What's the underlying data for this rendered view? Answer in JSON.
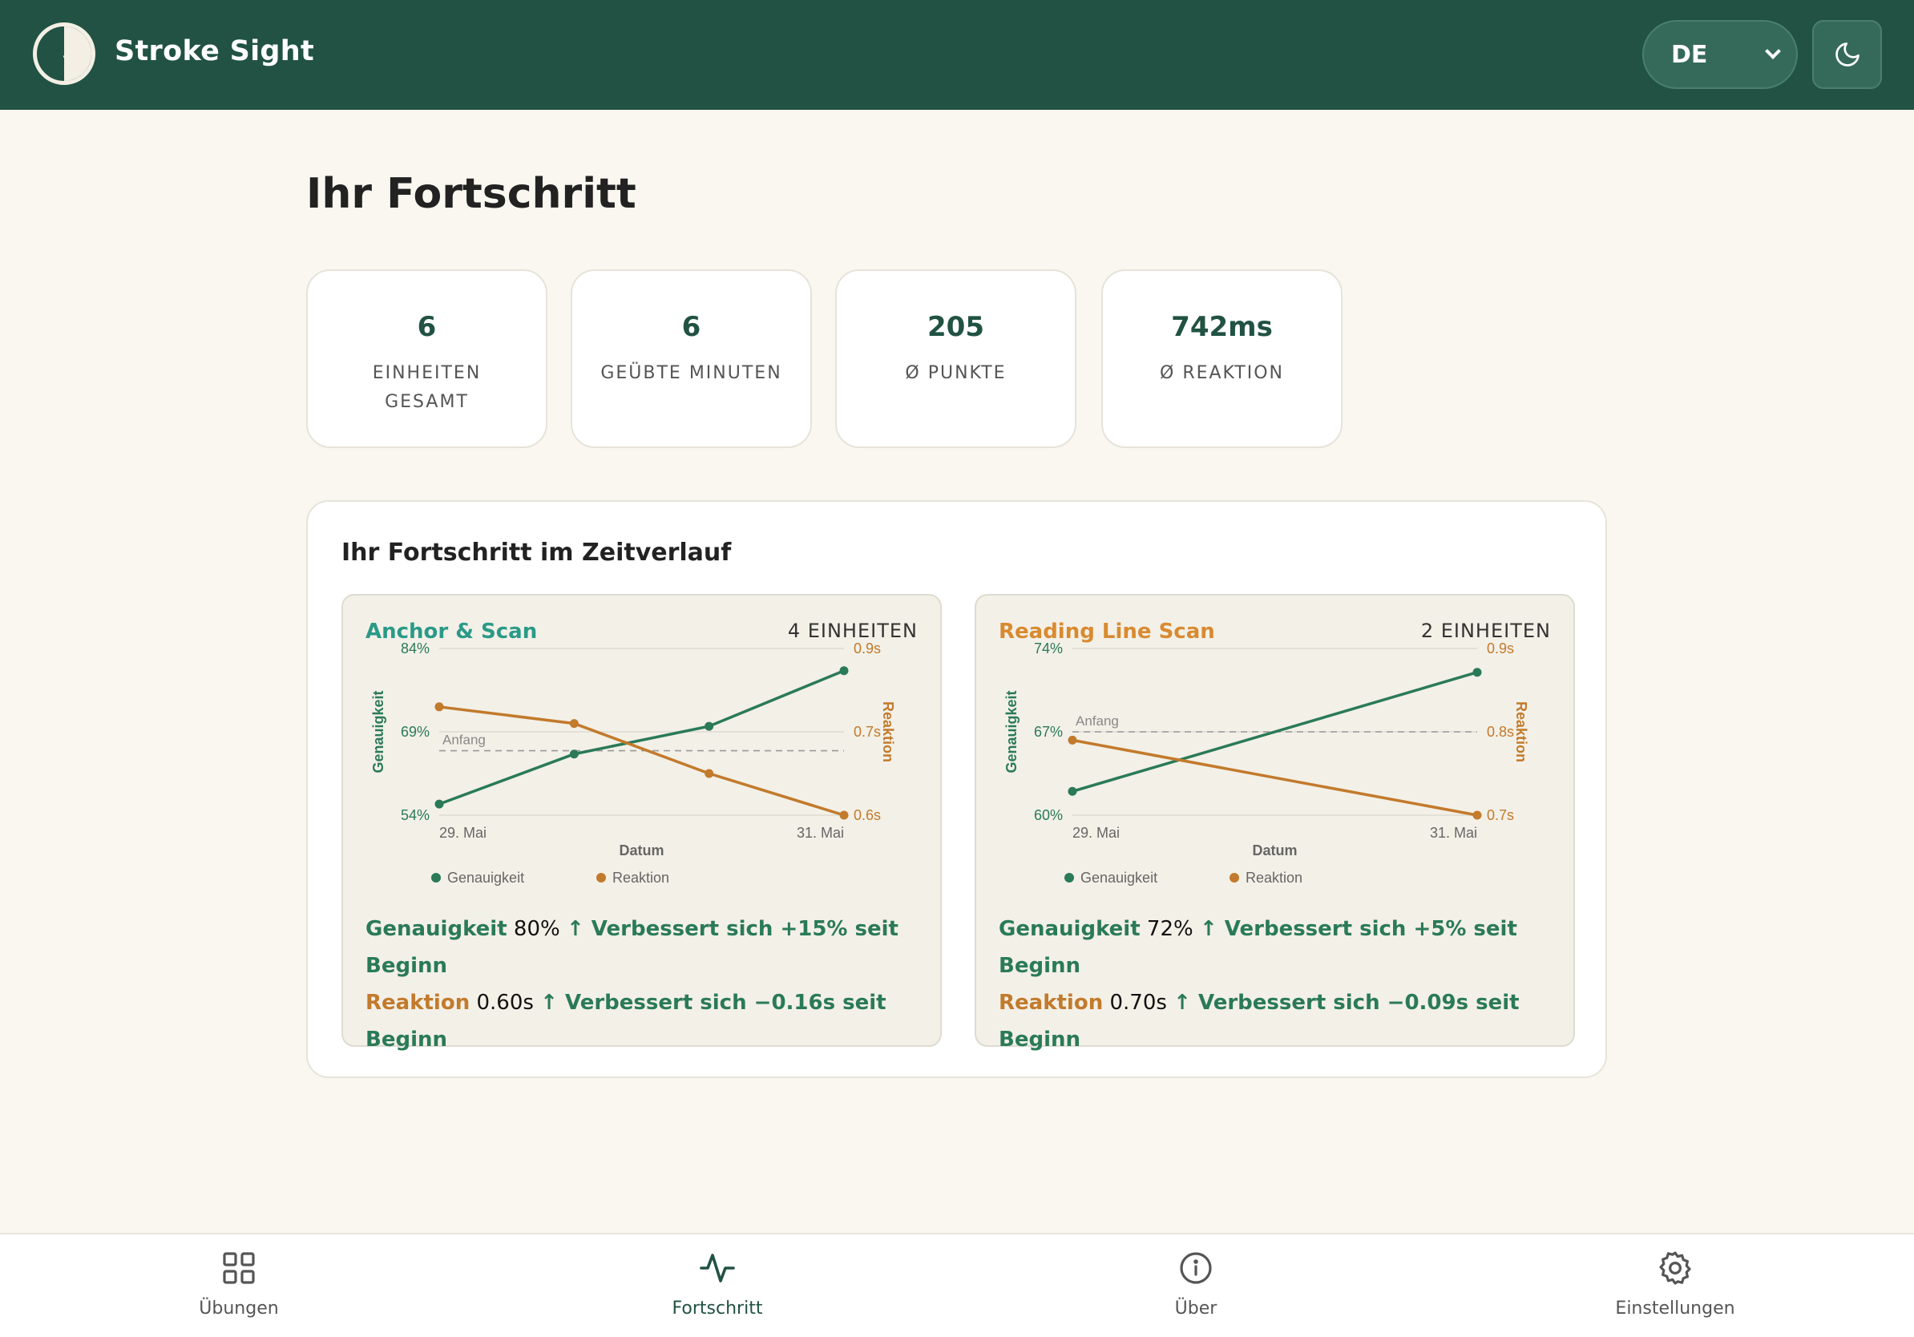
{
  "header": {
    "app_title": "Stroke Sight",
    "language": "DE",
    "icons": {
      "logo": "half-circle-logo",
      "chevron": "chevron-down-icon",
      "theme": "moon-icon"
    }
  },
  "page": {
    "title": "Ihr Fortschritt"
  },
  "stats": [
    {
      "value": "6",
      "label": "EINHEITEN GESAMT"
    },
    {
      "value": "6",
      "label": "GEÜBTE MINUTEN"
    },
    {
      "value": "205",
      "label": "Ø PUNKTE"
    },
    {
      "value": "742ms",
      "label": "Ø REAKTION"
    }
  ],
  "progress": {
    "title": "Ihr Fortschritt im Zeitverlauf",
    "cards": [
      {
        "name": "Anchor & Scan",
        "name_color": "#2a9a88",
        "count": "4 EINHEITEN",
        "summary": {
          "acc_key": "Genauigkeit",
          "acc_value": "80%",
          "acc_trend": "↑ Verbessert sich +15% seit Beginn",
          "rt_key": "Reaktion",
          "rt_value": "0.60s",
          "rt_trend": "↑ Verbessert sich −0.16s seit Beginn"
        }
      },
      {
        "name": "Reading Line Scan",
        "name_color": "#d98a30",
        "count": "2 EINHEITEN",
        "summary": {
          "acc_key": "Genauigkeit",
          "acc_value": "72%",
          "acc_trend": "↑ Verbessert sich +5% seit Beginn",
          "rt_key": "Reaktion",
          "rt_value": "0.70s",
          "rt_trend": "↑ Verbessert sich −0.09s seit Beginn"
        }
      }
    ]
  },
  "chart_data": [
    {
      "type": "line",
      "xlabel": "Datum",
      "x_ticks": [
        "29. Mai",
        "31. Mai"
      ],
      "y_left_label": "Genauigkeit",
      "y_left_ticks": [
        "84%",
        "69%",
        "54%"
      ],
      "y_left_range": [
        54,
        84
      ],
      "y_right_label": "Reaktion",
      "y_right_ticks": [
        "0.9s",
        "0.7s",
        "0.6s"
      ],
      "baseline_label": "Anfang",
      "series": [
        {
          "name": "Genauigkeit",
          "color": "#2a7a58",
          "axis": "left",
          "values": [
            56,
            65,
            70,
            80
          ]
        },
        {
          "name": "Reaktion",
          "color": "#c27a2c",
          "axis": "right",
          "values": [
            0.76,
            0.72,
            0.65,
            0.6
          ]
        }
      ],
      "legend": [
        "Genauigkeit",
        "Reaktion"
      ],
      "colors": {
        "accuracy": "#2a7a58",
        "reaction": "#c27a2c",
        "grid": "#dddad2",
        "baseline": "#999999"
      }
    },
    {
      "type": "line",
      "xlabel": "Datum",
      "x_ticks": [
        "29. Mai",
        "31. Mai"
      ],
      "y_left_label": "Genauigkeit",
      "y_left_ticks": [
        "74%",
        "67%",
        "60%"
      ],
      "y_left_range": [
        60,
        74
      ],
      "y_right_label": "Reaktion",
      "y_right_ticks": [
        "0.9s",
        "0.8s",
        "0.7s"
      ],
      "baseline_label": "Anfang",
      "series": [
        {
          "name": "Genauigkeit",
          "color": "#2a7a58",
          "axis": "left",
          "values": [
            62,
            72
          ]
        },
        {
          "name": "Reaktion",
          "color": "#c27a2c",
          "axis": "right",
          "values": [
            0.79,
            0.7
          ]
        }
      ],
      "legend": [
        "Genauigkeit",
        "Reaktion"
      ],
      "colors": {
        "accuracy": "#2a7a58",
        "reaction": "#c27a2c",
        "grid": "#dddad2",
        "baseline": "#999999"
      }
    }
  ],
  "nav": [
    {
      "label": "Übungen",
      "icon": "grid-icon",
      "active": false
    },
    {
      "label": "Fortschritt",
      "icon": "activity-icon",
      "active": true
    },
    {
      "label": "Über",
      "icon": "info-icon",
      "active": false
    },
    {
      "label": "Einstellungen",
      "icon": "gear-icon",
      "active": false
    }
  ]
}
